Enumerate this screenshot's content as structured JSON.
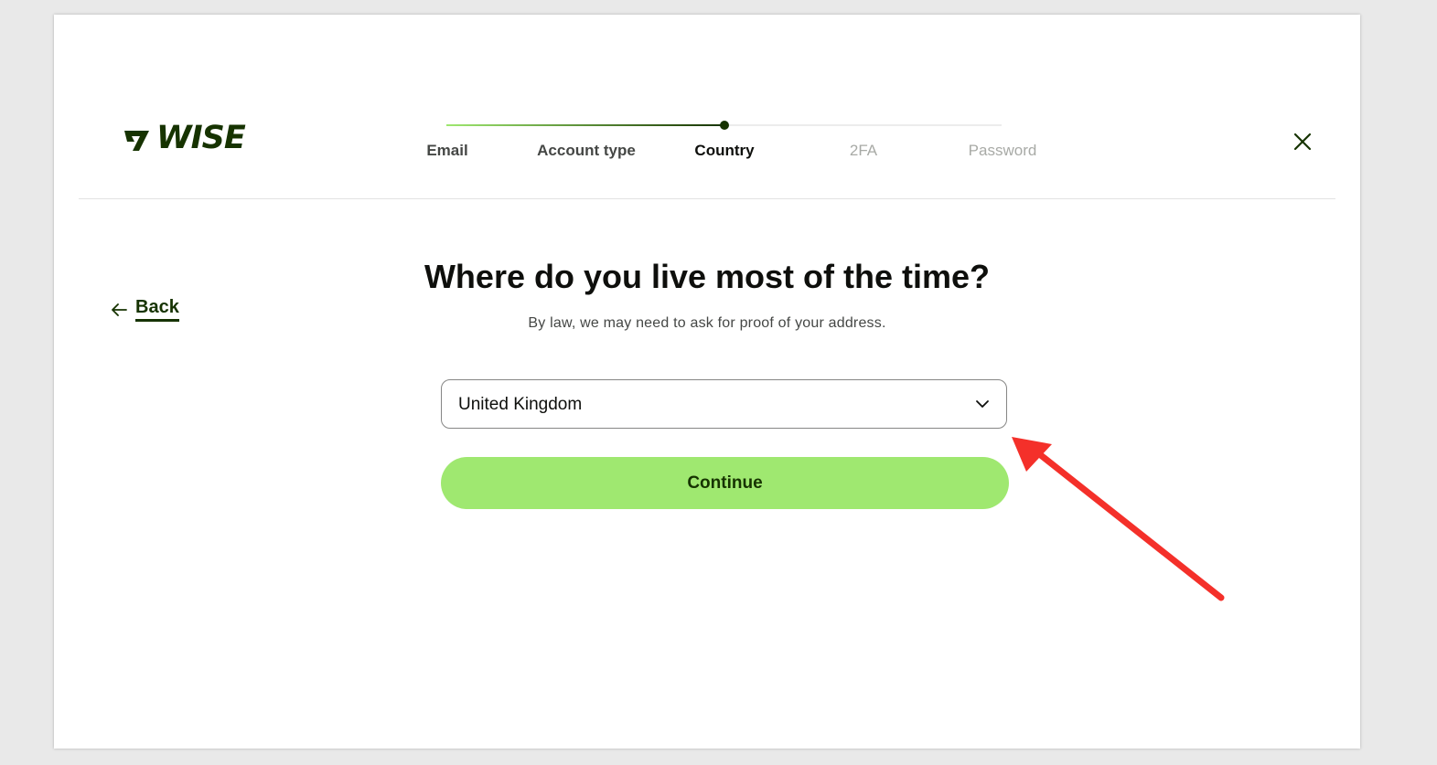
{
  "brand": {
    "name": "WISE",
    "color": "#163300",
    "accent": "#9fe870"
  },
  "stepper": {
    "progress": 0.5,
    "steps": [
      {
        "label": "Email",
        "state": "done"
      },
      {
        "label": "Account type",
        "state": "done"
      },
      {
        "label": "Country",
        "state": "active"
      },
      {
        "label": "2FA",
        "state": "todo"
      },
      {
        "label": "Password",
        "state": "todo"
      }
    ]
  },
  "header": {
    "close_icon": "close-icon"
  },
  "nav": {
    "back_label": "Back",
    "back_icon": "arrow-left-icon"
  },
  "main": {
    "title": "Where do you live most of the time?",
    "subtitle": "By law, we may need to ask for proof of your address.",
    "country_select": {
      "value": "United Kingdom",
      "icon": "chevron-down-icon"
    },
    "continue_label": "Continue"
  },
  "annotation": {
    "icon": "red-arrow-pointer",
    "color": "#f4302a"
  }
}
